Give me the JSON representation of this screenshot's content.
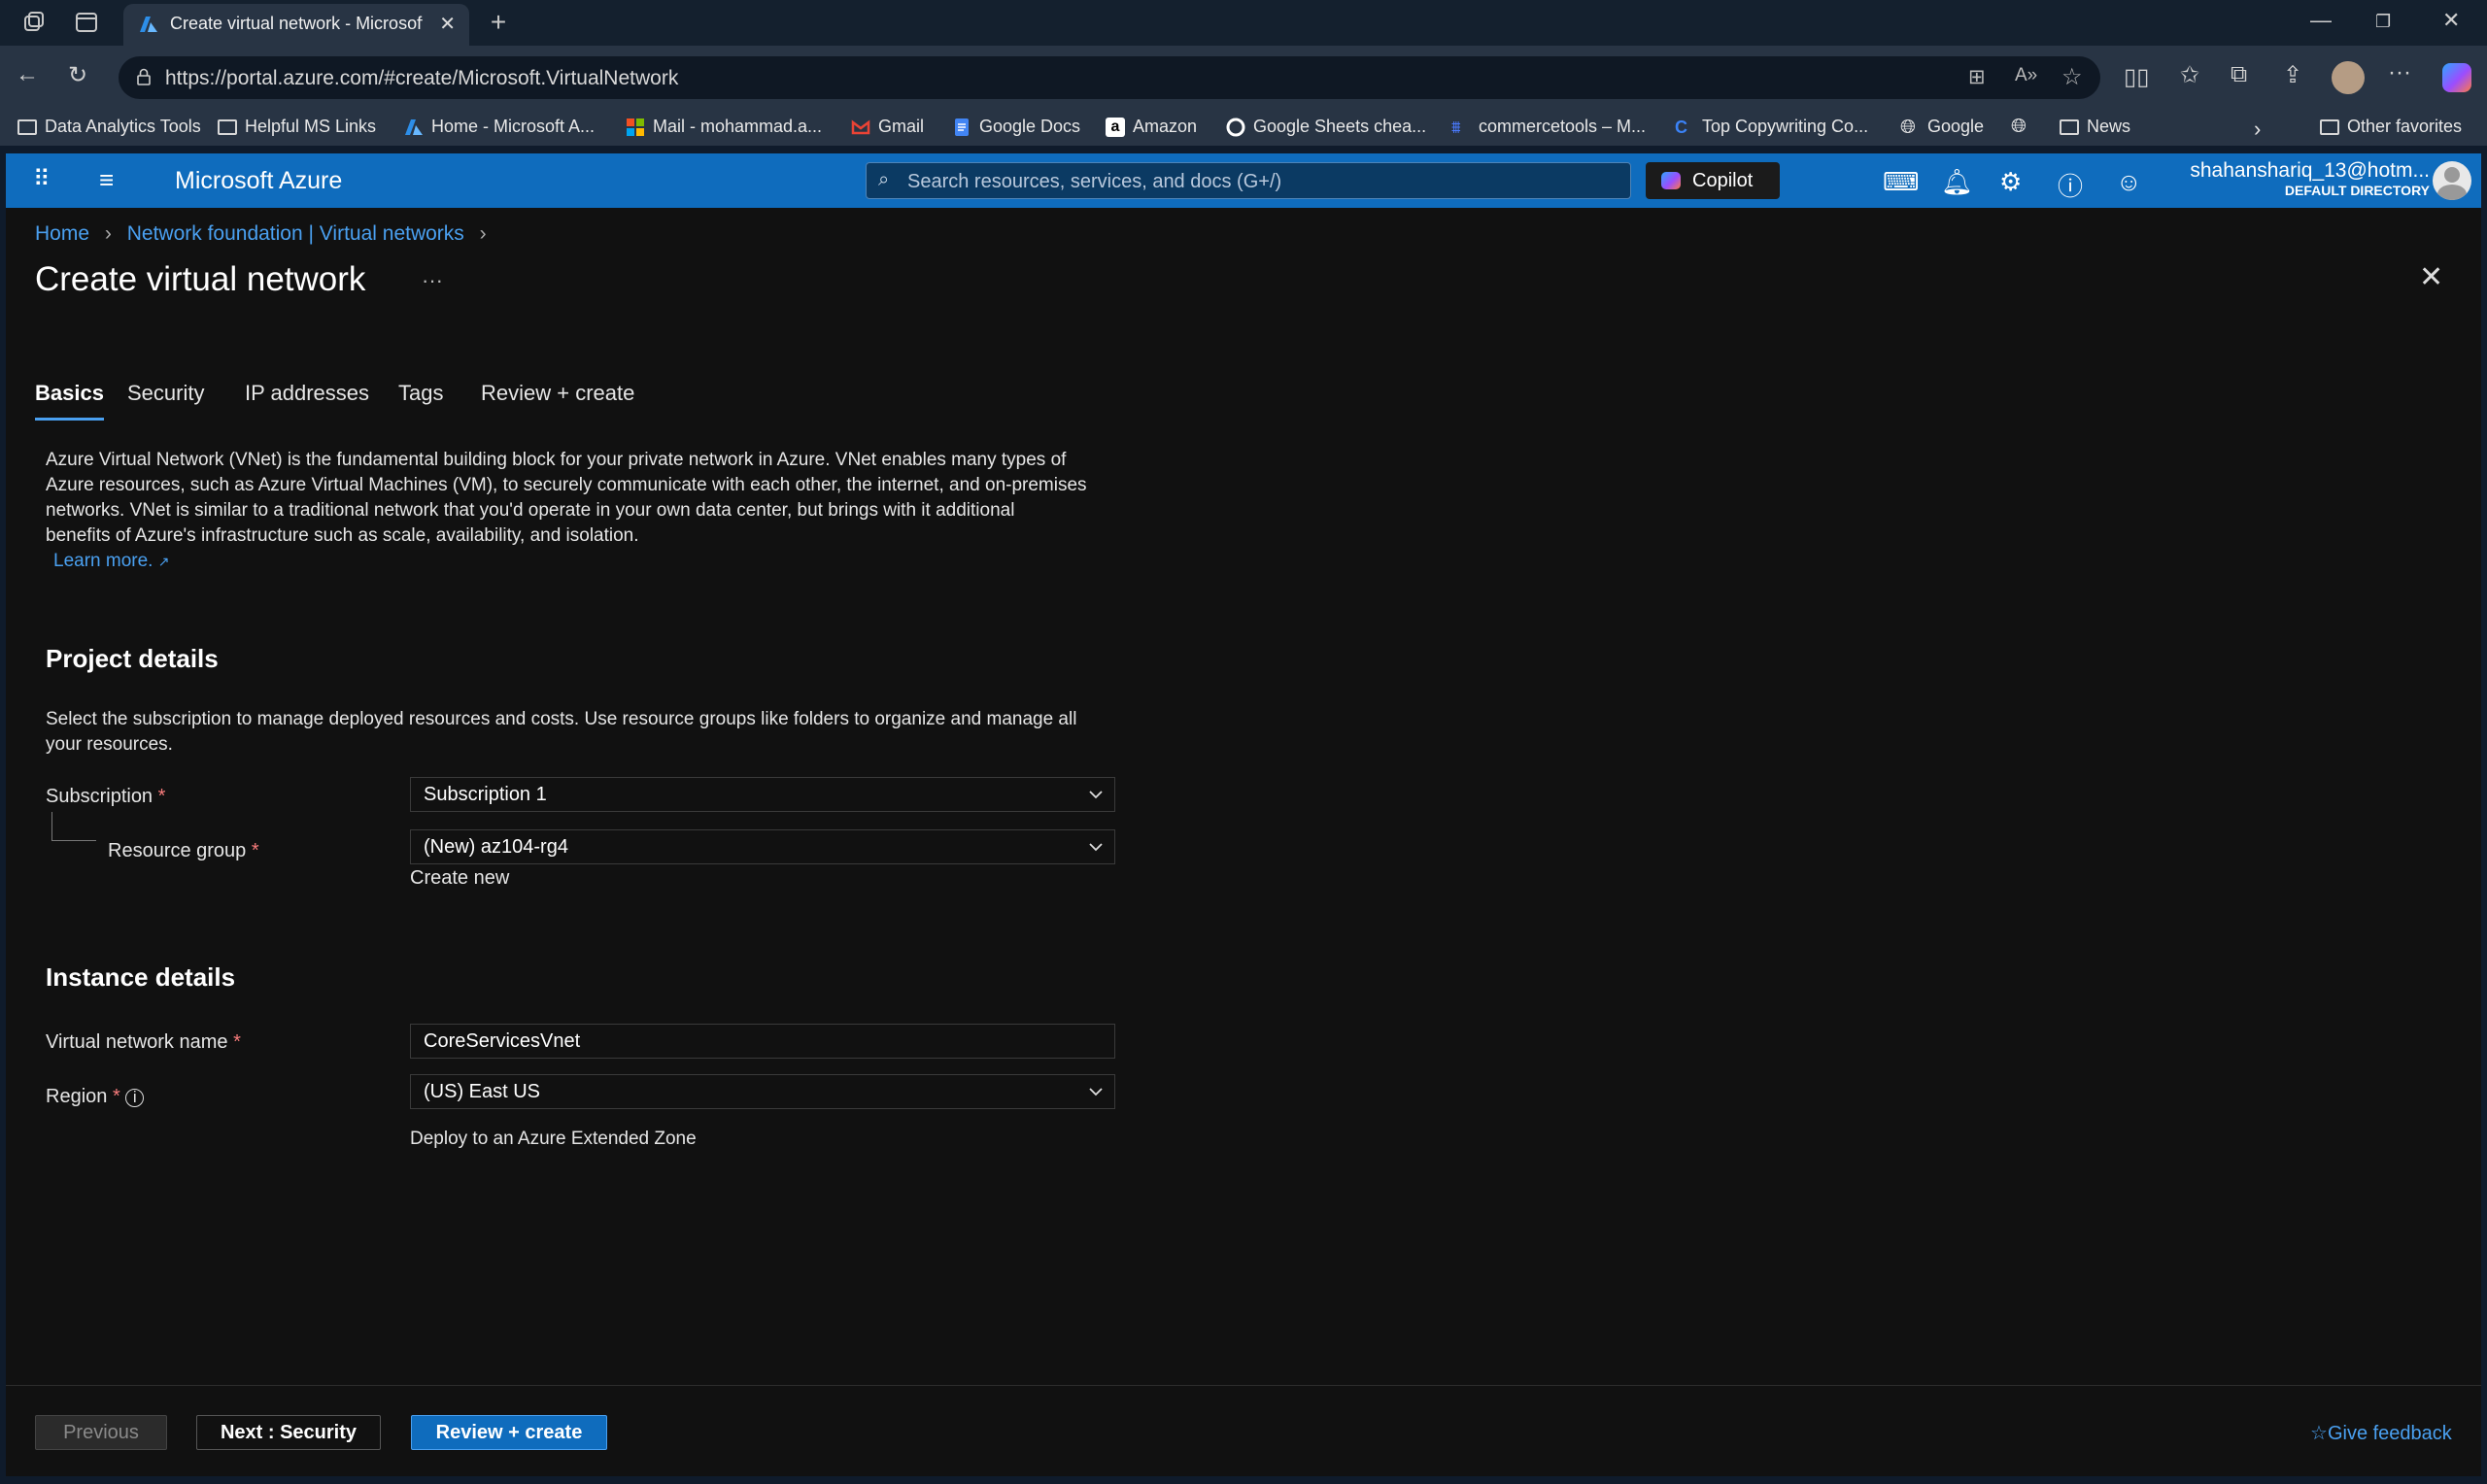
{
  "browser": {
    "tab_title": "Create virtual network - Microsoft",
    "url": "https://portal.azure.com/#create/Microsoft.VirtualNetwork",
    "bookmarks": [
      "Data Analytics Tools",
      "Helpful MS Links",
      "Home - Microsoft A...",
      "Mail - mohammad.a...",
      "Gmail",
      "Google Docs",
      "Amazon",
      "Google Sheets chea...",
      "commercetools – M...",
      "Top Copywriting Co...",
      "Google",
      "News"
    ],
    "other_favorites": "Other favorites"
  },
  "portal": {
    "brand": "Microsoft Azure",
    "search_placeholder": "Search resources, services, and docs (G+/)",
    "copilot": "Copilot",
    "user_name": "shahanshariq_13@hotm...",
    "user_directory": "DEFAULT DIRECTORY"
  },
  "breadcrumb": {
    "home": "Home",
    "parent": "Network foundation | Virtual networks"
  },
  "page": {
    "title": "Create virtual network",
    "more": "···"
  },
  "tabs": [
    "Basics",
    "Security",
    "IP addresses",
    "Tags",
    "Review + create"
  ],
  "intro": {
    "lines": [
      "Azure Virtual Network (VNet) is the fundamental building block for your private network in Azure. VNet enables many types of",
      "Azure resources, such as Azure Virtual Machines (VM), to securely communicate with each other, the internet, and on-premises",
      "networks. VNet is similar to a traditional network that you'd operate in your own data center, but brings with it additional",
      "benefits of Azure's infrastructure such as scale, availability, and isolation."
    ],
    "learn_more": "Learn more."
  },
  "project": {
    "heading": "Project details",
    "desc_lines": [
      "Select the subscription to manage deployed resources and costs. Use resource groups like folders to organize and manage all",
      "your resources."
    ],
    "subscription_label": "Subscription",
    "subscription_value": "Subscription 1",
    "rg_label": "Resource group",
    "rg_value": "(New) az104-rg4",
    "create_new": "Create new"
  },
  "instance": {
    "heading": "Instance details",
    "vnet_label": "Virtual network name",
    "vnet_value": "CoreServicesVnet",
    "region_label": "Region",
    "region_value": "(US) East US",
    "extended_zone": "Deploy to an Azure Extended Zone"
  },
  "footer": {
    "previous": "Previous",
    "next": "Next : Security",
    "review": "Review + create",
    "feedback": "Give feedback"
  },
  "colors": {
    "azure_blue": "#0f6cbd",
    "link": "#4aa0f0",
    "required": "#f87c7c",
    "primary_button": "#0f6cbd"
  }
}
